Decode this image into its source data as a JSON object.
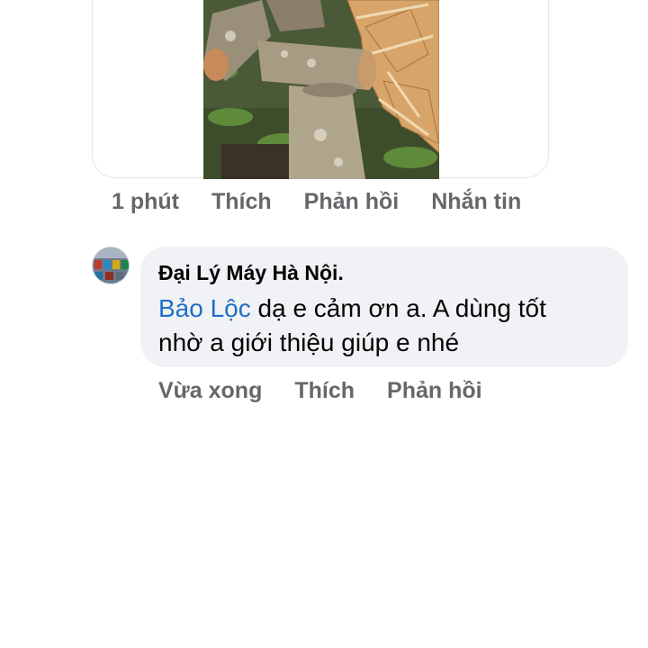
{
  "prev_comment": {
    "attachment_icon": "photo-of-cut-logs",
    "time": "1 phút",
    "like": "Thích",
    "reply": "Phản hồi",
    "message": "Nhắn tin"
  },
  "reply_comment": {
    "avatar_icon": "avatar-shop-photo",
    "author": "Đại Lý Máy Hà Nội.",
    "mention": "Bảo Lộc",
    "text_line1": " dạ e cảm ơn a. A dùng tốt",
    "text_line2": "nhờ a giới thiệu giúp e nhé",
    "time": "Vừa xong",
    "like": "Thích",
    "reply": "Phản hồi"
  },
  "colors": {
    "mention": "#1f6fc5",
    "bubble_bg": "#f0f2f5",
    "action_text": "#65676b"
  }
}
